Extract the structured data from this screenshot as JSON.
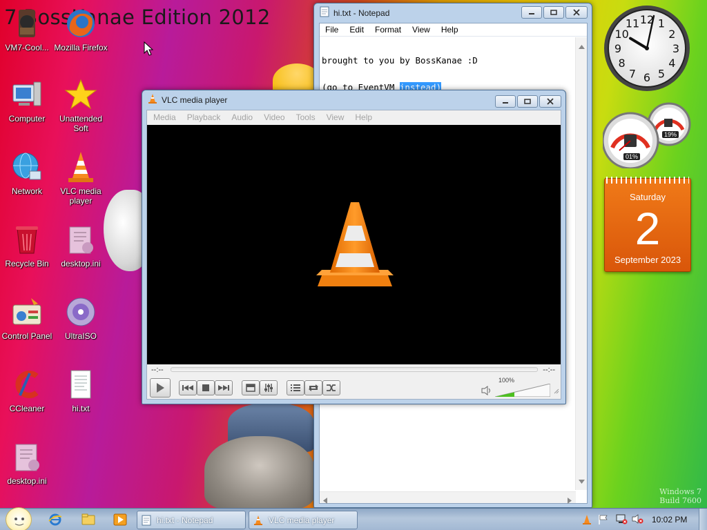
{
  "desktop": {
    "title": "7 BossKanae Edition 2012",
    "watermark_line1": "Windows 7",
    "watermark_line2": "Build 7600",
    "icons": [
      {
        "label": "VM7-Cool...",
        "icon": "vm-tool-icon"
      },
      {
        "label": "Mozilla Firefox",
        "icon": "firefox-icon"
      },
      {
        "label": "Computer",
        "icon": "computer-icon"
      },
      {
        "label": "Unattended Soft",
        "icon": "star-icon"
      },
      {
        "label": "Network",
        "icon": "network-icon"
      },
      {
        "label": "VLC media player",
        "icon": "vlc-cone-icon"
      },
      {
        "label": "Recycle Bin",
        "icon": "recycle-bin-icon"
      },
      {
        "label": "desktop.ini",
        "icon": "ini-file-icon"
      },
      {
        "label": "Control Panel",
        "icon": "control-panel-icon"
      },
      {
        "label": "UltraISO",
        "icon": "disc-icon"
      },
      {
        "label": "CCleaner",
        "icon": "ccleaner-icon"
      },
      {
        "label": "hi.txt",
        "icon": "text-file-icon"
      },
      {
        "label": "desktop.ini",
        "icon": "ini-file-icon"
      }
    ]
  },
  "notepad": {
    "title": "hi.txt - Notepad",
    "menu": [
      "File",
      "Edit",
      "Format",
      "View",
      "Help"
    ],
    "line1": "brought to you by BossKanae :D",
    "line2_prefix": "(go to EventVM ",
    "line2_selected": "instead)"
  },
  "vlc": {
    "title": "VLC media player",
    "menu": [
      "Media",
      "Playback",
      "Audio",
      "Video",
      "Tools",
      "View",
      "Help"
    ],
    "time_elapsed": "--:--",
    "time_total": "--:--",
    "volume": "100%",
    "volume_level": 0.35
  },
  "gadgets": {
    "clock": {
      "hour": 10,
      "minute": 2,
      "numbers": [
        "12",
        "1",
        "2",
        "3",
        "4",
        "5",
        "6",
        "7",
        "8",
        "9",
        "10",
        "11"
      ]
    },
    "cpu_meter": {
      "cpu": "01%",
      "memory": "19%"
    },
    "calendar": {
      "weekday": "Saturday",
      "day": "2",
      "month_year": "September 2023"
    }
  },
  "taskbar": {
    "tasks": [
      {
        "label": "hi.txt - Notepad"
      },
      {
        "label": "VLC media player"
      }
    ],
    "clock": "10:02 PM"
  },
  "colors": {
    "selection": "#3399ff",
    "vlc_orange": "#f68b1f",
    "calendar_orange": "#e05a08"
  }
}
